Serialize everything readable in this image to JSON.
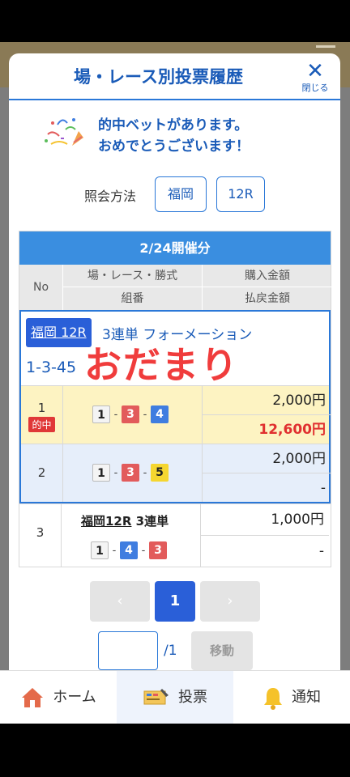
{
  "modal": {
    "title": "場・レース別投票履歴",
    "close_label": "閉じる",
    "hit_line1": "的中ベットがあります。",
    "hit_line2": "おめでとうございます！"
  },
  "query": {
    "label": "照会方法",
    "place": "福岡",
    "race": "12R"
  },
  "table": {
    "date_header": "2/24開催分",
    "headers": {
      "no": "No",
      "race": "場・レース・勝式",
      "buy": "購入金額",
      "combo": "組番",
      "payout": "払戻金額"
    },
    "group": {
      "race_badge": "福岡 12R",
      "bet_type": "3連単 フォーメーション",
      "combo": "1-3-45",
      "nickname": "おだまり"
    },
    "rows": [
      {
        "no": "1",
        "hit_label": "的中",
        "boats": [
          "1",
          "3",
          "4"
        ],
        "buy": "2,000円",
        "payout": "12,600円"
      },
      {
        "no": "2",
        "boats": [
          "1",
          "3",
          "5"
        ],
        "buy": "2,000円",
        "payout": "-"
      },
      {
        "no": "3",
        "race": "福岡12R",
        "bet_type": "3連単",
        "boats": [
          "1",
          "4",
          "3"
        ],
        "buy": "1,000円",
        "payout": "-"
      }
    ]
  },
  "pager": {
    "prev": "‹",
    "current": "1",
    "next": "›",
    "total": "/1",
    "move_label": "移動",
    "input_value": ""
  },
  "tabbar": {
    "home": "ホーム",
    "bet": "投票",
    "notice": "通知"
  },
  "colors": {
    "accent": "#2a78d8",
    "hit_red": "#e03030",
    "nickname_red": "#f03c3c"
  }
}
